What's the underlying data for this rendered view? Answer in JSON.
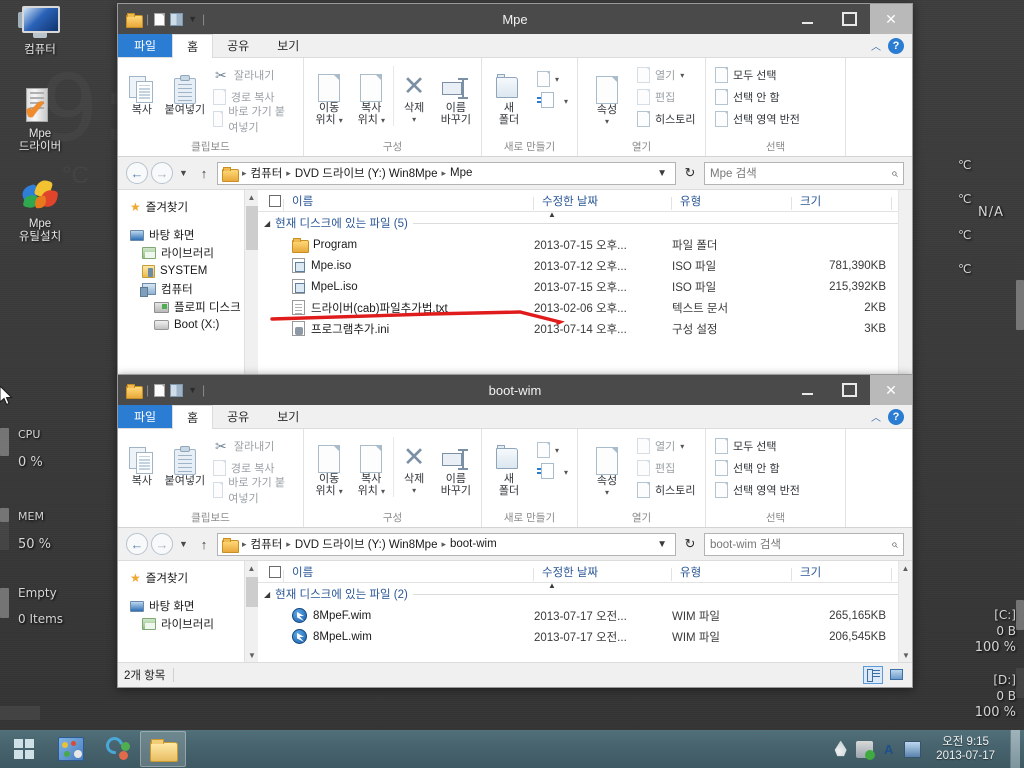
{
  "desktop": {
    "icons": [
      {
        "name": "컴퓨터",
        "icon": "computer-icon"
      },
      {
        "name": "Mpe\n드라이버",
        "line1": "Mpe",
        "line2": "드라이버",
        "icon": "drive-icon"
      },
      {
        "name": "Mpe\n유틸설치",
        "line1": "Mpe",
        "line2": "유틸설치",
        "icon": "butterfly-icon"
      }
    ],
    "ghost_clock": "9:",
    "ghost_unit": "°C"
  },
  "gadgets": {
    "left": [
      {
        "label": "CPU",
        "value": "0 %"
      },
      {
        "label": "MEM",
        "value": "50 %"
      },
      {
        "label": "Empty",
        "value": "0  Items"
      }
    ],
    "right_temps": [
      "℃",
      "℃",
      "℃",
      "℃"
    ],
    "right_na": "N/A",
    "drives": [
      {
        "label": "[C:]",
        "free": "0 B",
        "pct": "100 %"
      },
      {
        "label": "[D:]",
        "free": "0 B",
        "pct": "100 %"
      }
    ]
  },
  "windows": [
    {
      "id": "mpe",
      "title": "Mpe",
      "ribbon_tabs": [
        {
          "label": "파일",
          "type": "file"
        },
        {
          "label": "홈",
          "type": "active"
        },
        {
          "label": "공유",
          "type": "normal"
        },
        {
          "label": "보기",
          "type": "normal"
        }
      ],
      "ribbon_groups": [
        {
          "name": "클립보드",
          "big": [
            {
              "label": "복사",
              "icon": "copy-icon"
            },
            {
              "label": "붙여넣기",
              "icon": "paste-icon"
            }
          ],
          "small": [
            {
              "label": "잘라내기",
              "icon": "scissors-icon",
              "enabled": false
            },
            {
              "label": "경로 복사",
              "icon": "page-icon",
              "enabled": false
            },
            {
              "label": "바로 가기 붙여넣기",
              "icon": "page-icon",
              "enabled": false
            }
          ]
        },
        {
          "name": "구성",
          "big": [
            {
              "label": "이동\n위치",
              "l1": "이동",
              "l2": "위치",
              "icon": "move-to-icon",
              "caret": true
            },
            {
              "label": "복사\n위치",
              "l1": "복사",
              "l2": "위치",
              "icon": "copy-to-icon",
              "caret": true
            },
            {
              "label": "삭제",
              "l1": "삭제",
              "l2": "",
              "icon": "delete-x-icon",
              "caret": true
            },
            {
              "label": "이름\n바꾸기",
              "l1": "이름",
              "l2": "바꾸기",
              "icon": "rename-icon"
            }
          ]
        },
        {
          "name": "새로 만들기",
          "big": [
            {
              "label": "새\n폴더",
              "l1": "새",
              "l2": "폴더",
              "icon": "new-folder-icon"
            }
          ],
          "small": [
            {
              "label": "",
              "icon": "new-item-icon",
              "caret": true,
              "enabled": true
            },
            {
              "label": "",
              "icon": "easy-access-icon",
              "caret": true,
              "enabled": true
            }
          ]
        },
        {
          "name": "열기",
          "big": [
            {
              "label": "속성",
              "l1": "속성",
              "l2": "",
              "icon": "properties-icon",
              "caret": true
            }
          ],
          "small": [
            {
              "label": "열기",
              "icon": "open-icon",
              "enabled": false,
              "caret": true
            },
            {
              "label": "편집",
              "icon": "edit-icon",
              "enabled": false
            },
            {
              "label": "히스토리",
              "icon": "history-icon",
              "enabled": true
            }
          ]
        },
        {
          "name": "선택",
          "small": [
            {
              "label": "모두 선택",
              "icon": "select-all-icon",
              "enabled": true
            },
            {
              "label": "선택 안 함",
              "icon": "select-none-icon",
              "enabled": true
            },
            {
              "label": "선택 영역 반전",
              "icon": "invert-selection-icon",
              "enabled": true
            }
          ]
        }
      ],
      "breadcrumb": [
        "컴퓨터",
        "DVD 드라이브 (Y:) Win8Mpe",
        "Mpe"
      ],
      "search_placeholder": "Mpe 검색",
      "nav_items": [
        {
          "label": "즐겨찾기",
          "icon": "star-icon",
          "indent": 0
        },
        {
          "label": "바탕 화면",
          "icon": "desktop-icon",
          "indent": 0
        },
        {
          "label": "라이브러리",
          "icon": "library-icon",
          "indent": 1
        },
        {
          "label": "SYSTEM",
          "icon": "system-folder-icon",
          "indent": 1
        },
        {
          "label": "컴퓨터",
          "icon": "computer-icon",
          "indent": 1
        },
        {
          "label": "플로피 디스크",
          "icon": "floppy-icon",
          "indent": 2
        },
        {
          "label": "Boot (X:)",
          "icon": "harddisk-icon",
          "indent": 2
        }
      ],
      "columns": [
        "이름",
        "수정한 날짜",
        "유형",
        "크기"
      ],
      "group_label": "현재 디스크에 있는 파일 (5)",
      "files": [
        {
          "name": "Program",
          "date": "2013-07-15 오후...",
          "type": "파일 폴더",
          "size": "",
          "icon": "folder-icon"
        },
        {
          "name": "Mpe.iso",
          "date": "2013-07-12 오후...",
          "type": "ISO 파일",
          "size": "781,390KB",
          "icon": "iso-icon"
        },
        {
          "name": "MpeL.iso",
          "date": "2013-07-15 오후...",
          "type": "ISO 파일",
          "size": "215,392KB",
          "icon": "iso-icon"
        },
        {
          "name": "드라이버(cab)파일추가법.txt",
          "date": "2013-02-06 오후...",
          "type": "텍스트 문서",
          "size": "2KB",
          "icon": "txt-icon"
        },
        {
          "name": "프로그램추가.ini",
          "date": "2013-07-14 오후...",
          "type": "구성 설정",
          "size": "3KB",
          "icon": "ini-icon"
        }
      ]
    },
    {
      "id": "bootwim",
      "title": "boot-wim",
      "ribbon_tabs": [
        {
          "label": "파일",
          "type": "file"
        },
        {
          "label": "홈",
          "type": "active"
        },
        {
          "label": "공유",
          "type": "normal"
        },
        {
          "label": "보기",
          "type": "normal"
        }
      ],
      "breadcrumb": [
        "컴퓨터",
        "DVD 드라이브 (Y:) Win8Mpe",
        "boot-wim"
      ],
      "search_placeholder": "boot-wim 검색",
      "nav_items": [
        {
          "label": "즐겨찾기",
          "icon": "star-icon",
          "indent": 0
        },
        {
          "label": "바탕 화면",
          "icon": "desktop-icon",
          "indent": 0
        },
        {
          "label": "라이브러리",
          "icon": "library-icon",
          "indent": 1
        }
      ],
      "columns": [
        "이름",
        "수정한 날짜",
        "유형",
        "크기"
      ],
      "group_label": "현재 디스크에 있는 파일 (2)",
      "files": [
        {
          "name": "8MpeF.wim",
          "date": "2013-07-17 오전...",
          "type": "WIM 파일",
          "size": "265,165KB",
          "icon": "wim-icon"
        },
        {
          "name": "8MpeL.wim",
          "date": "2013-07-17 오전...",
          "type": "WIM 파일",
          "size": "206,545KB",
          "icon": "wim-icon"
        }
      ],
      "status": "2개 항목"
    }
  ],
  "taskbar": {
    "start_label": "시작",
    "items": [
      {
        "name": "paint-app",
        "active": false
      },
      {
        "name": "driver-app",
        "active": false
      },
      {
        "name": "explorer-app",
        "active": true
      }
    ],
    "tray": [
      "water-drop-icon",
      "usb-safe-icon",
      "ime-korean-icon",
      "display-icon"
    ],
    "clock_time": "오전 9:15",
    "clock_date": "2013-07-17"
  },
  "colors": {
    "accent": "#2b7cd3",
    "taskbar": "#46626c",
    "titlebar": "#4a4a4a",
    "annotation": "#e01b1b"
  }
}
